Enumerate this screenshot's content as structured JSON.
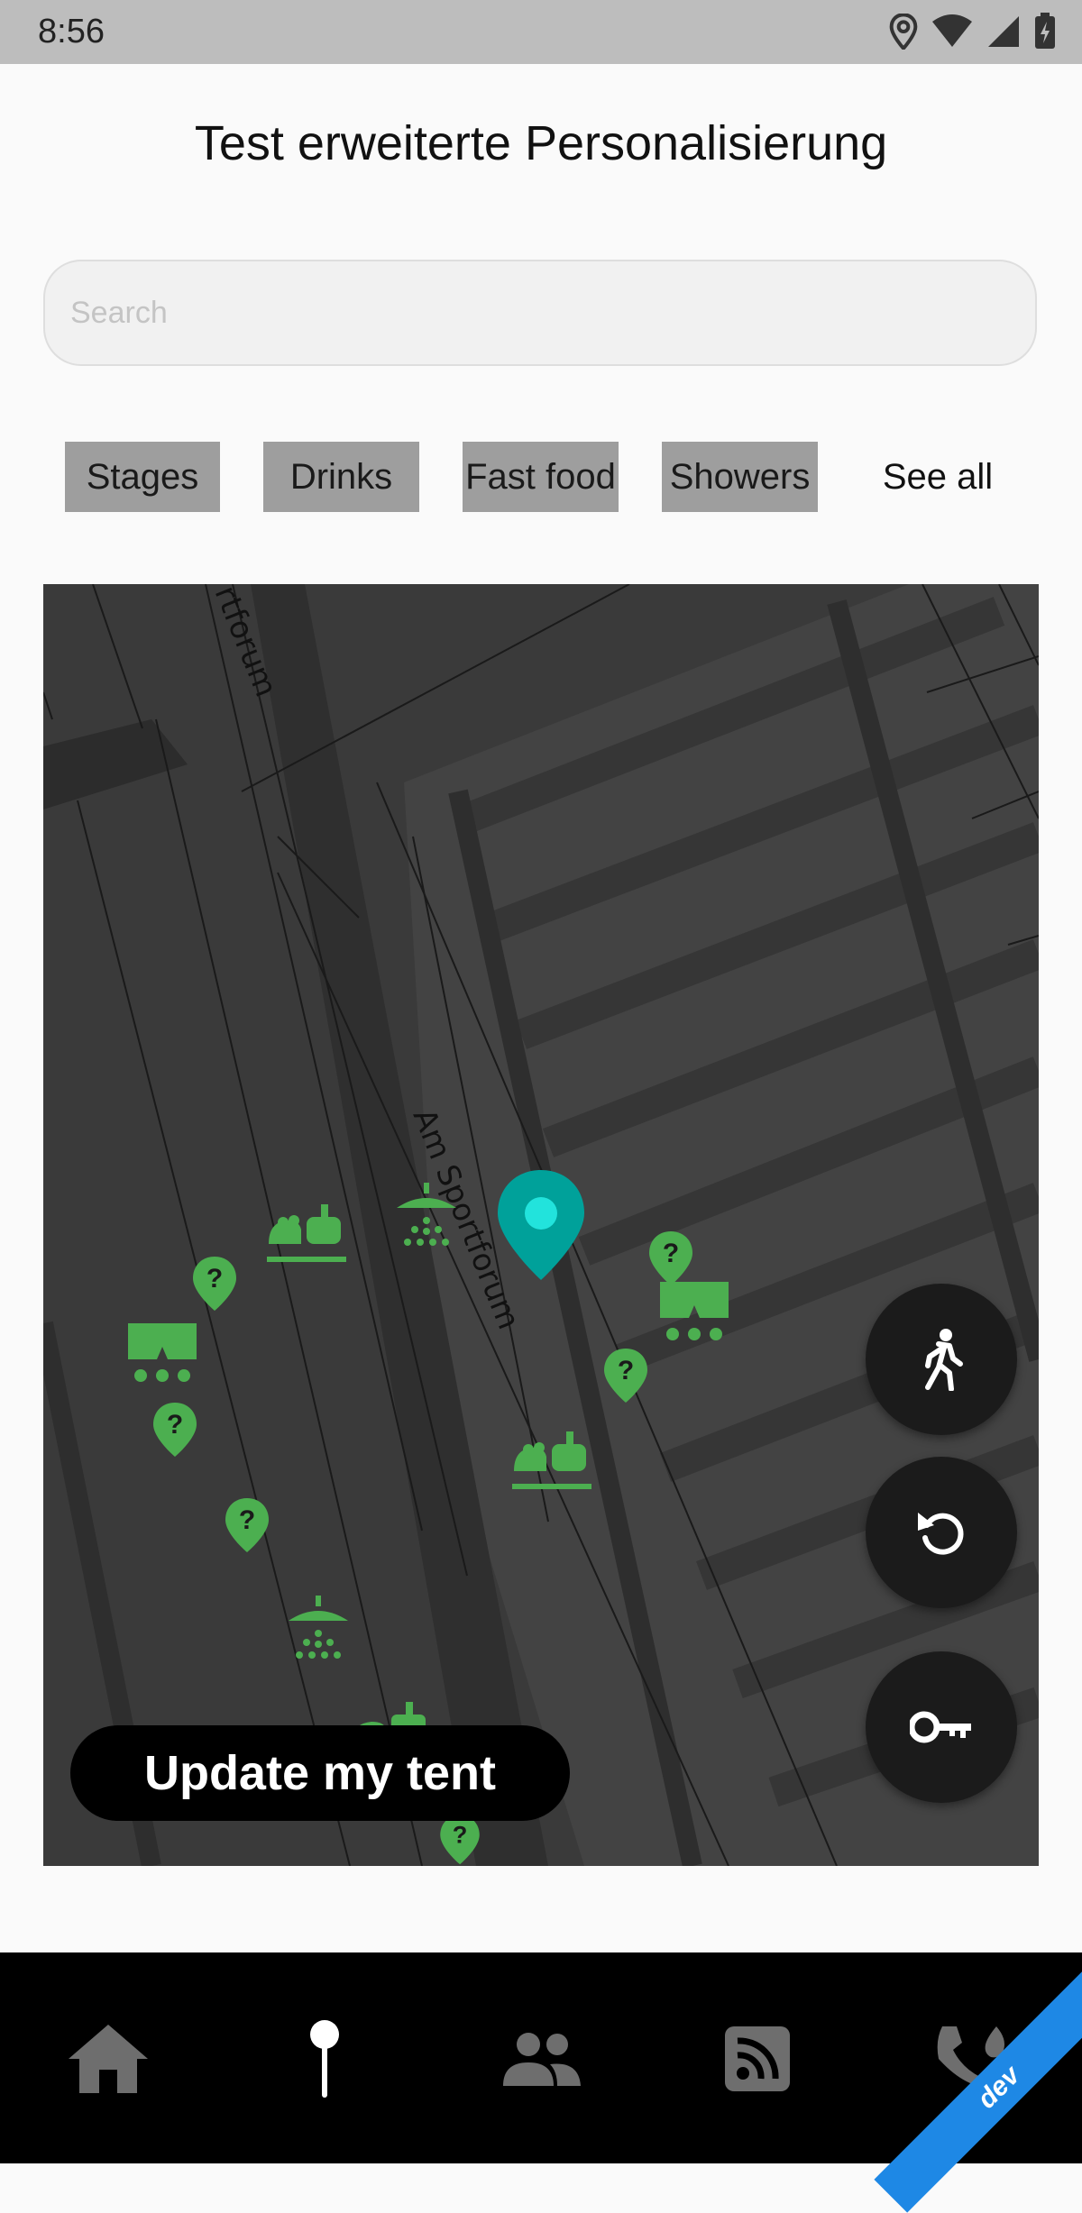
{
  "status": {
    "time": "8:56"
  },
  "header": {
    "title": "Test erweiterte Personalisierung"
  },
  "search": {
    "placeholder": "Search",
    "value": ""
  },
  "chips": [
    {
      "label": "Stages"
    },
    {
      "label": "Drinks"
    },
    {
      "label": "Fast food"
    },
    {
      "label": "Showers"
    }
  ],
  "see_all": "See all",
  "map": {
    "street_labels": [
      "rtforum",
      "Am Sportforum"
    ],
    "update_button": "Update my tent",
    "poi_color": "#4caf50",
    "pin_color": "#00a19a"
  },
  "fabs": [
    {
      "icon": "walk-icon"
    },
    {
      "icon": "refresh-icon"
    },
    {
      "icon": "key-icon"
    }
  ],
  "nav": [
    {
      "icon": "home-icon"
    },
    {
      "icon": "map-pin-icon"
    },
    {
      "icon": "group-icon"
    },
    {
      "icon": "rss-feed-icon"
    },
    {
      "icon": "emergency-call-icon"
    }
  ],
  "dev_badge": "dev"
}
